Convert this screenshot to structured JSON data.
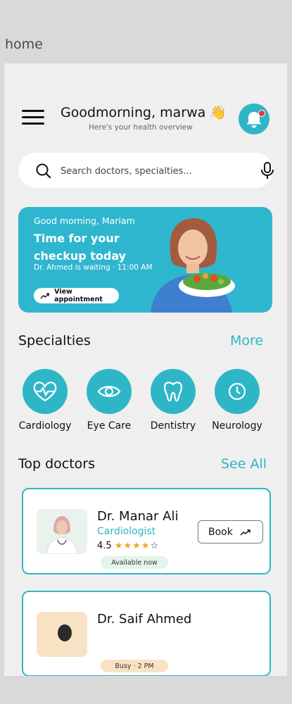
{
  "frame_label": "home",
  "header": {
    "greeting": "Goodmorning, marwa 👋",
    "subtitle": "Here's your health overview",
    "bell_icon": "bell-icon",
    "menu_icon": "hamburger-menu-icon"
  },
  "search": {
    "placeholder": "Search doctors, specialties...",
    "value": ""
  },
  "banner": {
    "hello": "Good morning, Mariam",
    "title": "Time for your checkup today",
    "waiting": "Dr. Ahmed is waiting · 11:00 AM",
    "button": "View appointment"
  },
  "specialties": {
    "title": "Specialties",
    "more": "More",
    "items": [
      {
        "label": "Cardiology",
        "icon": "heartbeat-icon"
      },
      {
        "label": "Eye Care",
        "icon": "eye-icon"
      },
      {
        "label": "Dentistry",
        "icon": "tooth-icon"
      },
      {
        "label": "Neurology",
        "icon": "clock-icon"
      }
    ]
  },
  "doctors": {
    "title": "Top doctors",
    "see_all": "See All",
    "items": [
      {
        "name": "Dr. Manar Ali",
        "specialty": "Cardiologist",
        "rating": "4.5",
        "stars": "★★★★",
        "empty_star": "☆",
        "status": "Available now",
        "book": "Book"
      },
      {
        "name": "Dr. Saif Ahmed",
        "status": "Busy · 2 PM"
      }
    ]
  },
  "nav": [
    "home-icon",
    "heart-icon",
    "chat-icon",
    "health-icon",
    "profile-icon"
  ],
  "colors": {
    "accent": "#2fb6c6",
    "background": "#efefef",
    "star": "#f2a61f"
  }
}
